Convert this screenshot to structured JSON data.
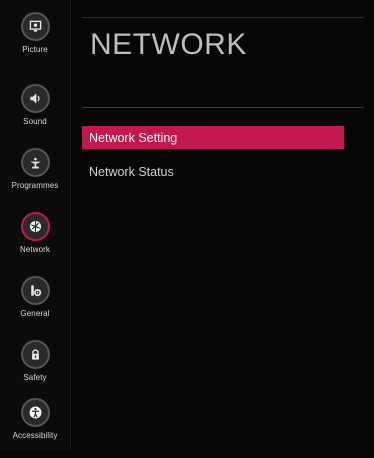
{
  "sidebar": {
    "items": [
      {
        "label": "Picture",
        "icon": "picture-icon",
        "active": false
      },
      {
        "label": "Sound",
        "icon": "sound-icon",
        "active": false
      },
      {
        "label": "Programmes",
        "icon": "antenna-icon",
        "active": false
      },
      {
        "label": "Network",
        "icon": "network-globe-icon",
        "active": true
      },
      {
        "label": "General",
        "icon": "tools-gear-icon",
        "active": false
      },
      {
        "label": "Safety",
        "icon": "lock-icon",
        "active": false
      },
      {
        "label": "Accessibility",
        "icon": "accessibility-person-icon",
        "active": false
      }
    ]
  },
  "main": {
    "title": "NETWORK",
    "menu": [
      {
        "label": "Network Setting",
        "selected": true
      },
      {
        "label": "Network Status",
        "selected": false
      }
    ]
  },
  "colors": {
    "accent": "#c2184e",
    "background": "#070707",
    "text": "#cfcfcf"
  }
}
